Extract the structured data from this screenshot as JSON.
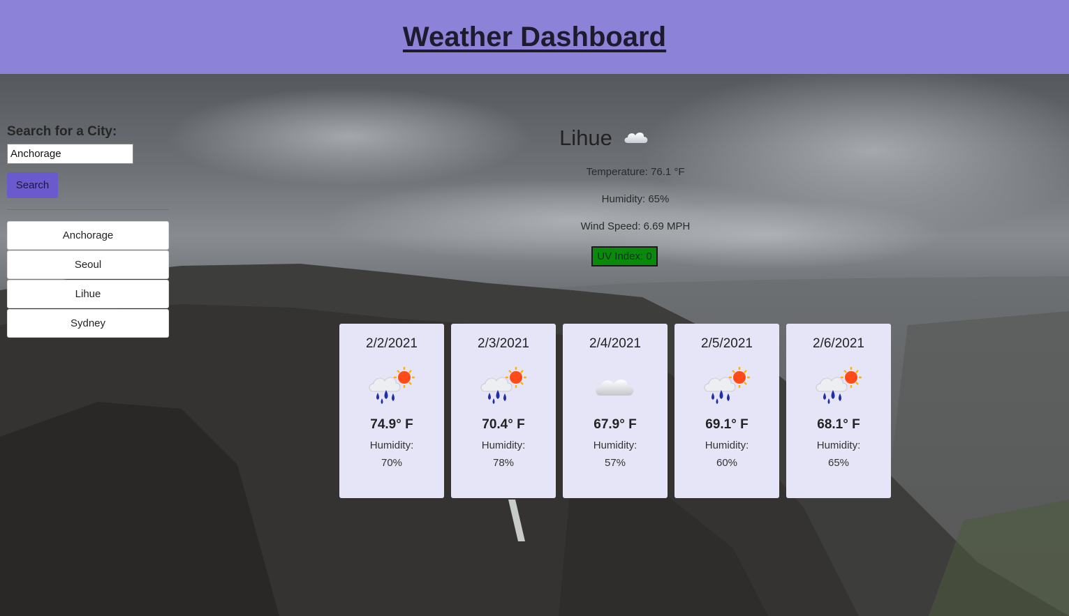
{
  "header": {
    "title": "Weather Dashboard"
  },
  "search": {
    "label": "Search for a City:",
    "value": "Anchorage",
    "button_label": "Search"
  },
  "history": [
    "Anchorage",
    "Seoul",
    "Lihue",
    "Sydney"
  ],
  "current": {
    "city": "Lihue",
    "icon": "cloud-icon",
    "temperature": "Temperature: 76.1 °F",
    "humidity": "Humidity: 65%",
    "wind": "Wind Speed: 6.69 MPH",
    "uv": "UV Index: 0",
    "uv_color": "#0a8a0a"
  },
  "forecast": [
    {
      "date": "2/2/2021",
      "icon": "rain-sun-icon",
      "temp": "74.9° F",
      "humidity_label": "Humidity:",
      "humidity": "70%"
    },
    {
      "date": "2/3/2021",
      "icon": "rain-sun-icon",
      "temp": "70.4° F",
      "humidity_label": "Humidity:",
      "humidity": "78%"
    },
    {
      "date": "2/4/2021",
      "icon": "cloud-icon",
      "temp": "67.9° F",
      "humidity_label": "Humidity:",
      "humidity": "57%"
    },
    {
      "date": "2/5/2021",
      "icon": "rain-sun-icon",
      "temp": "69.1° F",
      "humidity_label": "Humidity:",
      "humidity": "60%"
    },
    {
      "date": "2/6/2021",
      "icon": "rain-sun-icon",
      "temp": "68.1° F",
      "humidity_label": "Humidity:",
      "humidity": "65%"
    }
  ],
  "colors": {
    "header": "#8c82d8",
    "accent": "#6a5acd",
    "card": "#e6e5f8"
  }
}
